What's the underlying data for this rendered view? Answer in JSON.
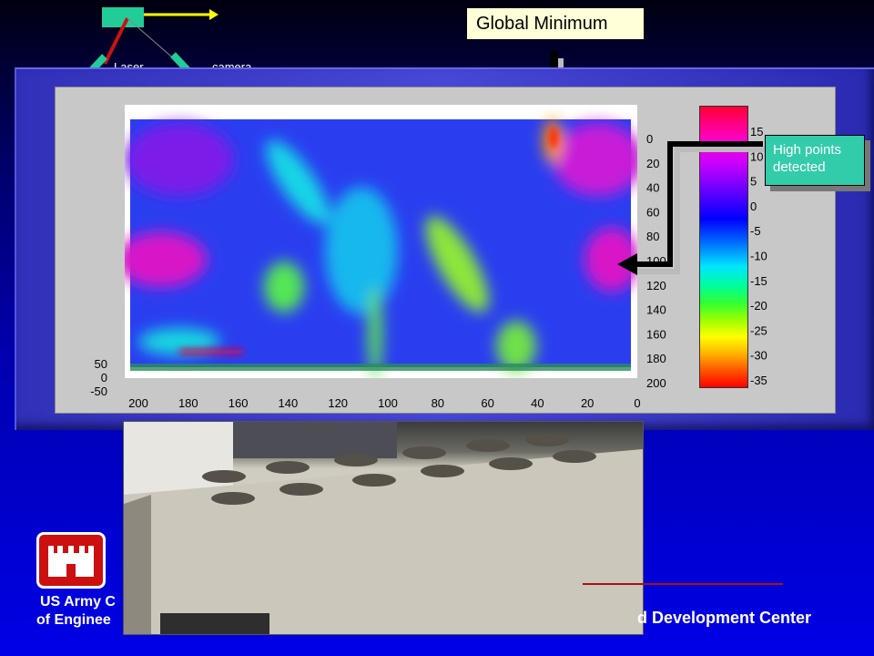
{
  "schematic": {
    "laser_label": "Laser",
    "camera_label": "camera"
  },
  "callouts": {
    "global_minimum": "Global Minimum",
    "high_points_line1": "High points",
    "high_points_line2": "detected"
  },
  "plot": {
    "y_ticks_right": [
      "0",
      "20",
      "40",
      "60",
      "80",
      "100",
      "120",
      "140",
      "160",
      "180",
      "200"
    ],
    "x_ticks": [
      "200",
      "180",
      "160",
      "140",
      "120",
      "100",
      "80",
      "60",
      "40",
      "20",
      "0"
    ],
    "z_ticks": [
      "50",
      "0",
      "-50"
    ],
    "colorbar_ticks": [
      "15",
      "10",
      "5",
      "0",
      "-5",
      "-10",
      "-15",
      "-20",
      "-25",
      "-30",
      "-35"
    ]
  },
  "footer": {
    "org_line1": "US Army C",
    "org_line2": "of Enginee",
    "center_name": "d Development Center"
  },
  "colors": {
    "background_dark": "#000010",
    "background_blue": "#0000e6",
    "callout": "#ffffd8",
    "high_points": "#33ccaa",
    "logo_red": "#cc1010"
  }
}
